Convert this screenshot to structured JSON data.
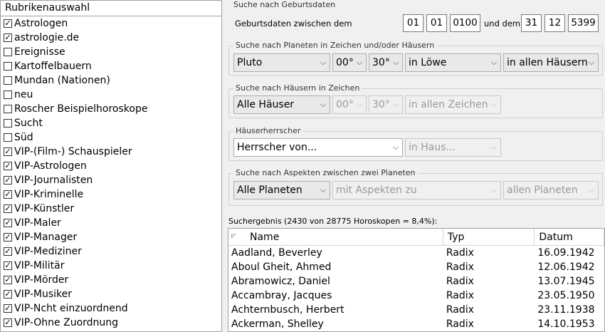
{
  "categories": {
    "header": "Rubrikenauswahl",
    "items": [
      {
        "label": "Astrologen",
        "checked": true
      },
      {
        "label": "astrologie.de",
        "checked": true
      },
      {
        "label": "Ereignisse",
        "checked": false
      },
      {
        "label": "Kartoffelbauern",
        "checked": false
      },
      {
        "label": "Mundan (Nationen)",
        "checked": false
      },
      {
        "label": "neu",
        "checked": false
      },
      {
        "label": "Roscher Beispielhoroskope",
        "checked": false
      },
      {
        "label": "Sucht",
        "checked": false
      },
      {
        "label": "Süd",
        "checked": false
      },
      {
        "label": "VIP-(Film-) Schauspieler",
        "checked": true
      },
      {
        "label": "VIP-Astrologen",
        "checked": true
      },
      {
        "label": "VIP-Journalisten",
        "checked": true
      },
      {
        "label": "VIP-Kriminelle",
        "checked": true
      },
      {
        "label": "VIP-Künstler",
        "checked": true
      },
      {
        "label": "VIP-Maler",
        "checked": true
      },
      {
        "label": "VIP-Manager",
        "checked": true
      },
      {
        "label": "VIP-Mediziner",
        "checked": true
      },
      {
        "label": "VIP-Militär",
        "checked": true
      },
      {
        "label": "VIP-Mörder",
        "checked": true
      },
      {
        "label": "VIP-Musiker",
        "checked": true
      },
      {
        "label": "VIP-Ncht einzuordnend",
        "checked": true
      },
      {
        "label": "VIP-Ohne Zuordnung",
        "checked": true
      }
    ]
  },
  "birth": {
    "title": "Suche nach Geburtsdaten",
    "label_between": "Geburtsdaten zwischen dem",
    "label_and": "und dem",
    "from_day": "01",
    "from_month": "01",
    "from_year": "0100",
    "to_day": "31",
    "to_month": "12",
    "to_year": "5399"
  },
  "planets": {
    "title": "Suche nach Planeten in Zeichen und/oder Häusern",
    "planet": "Pluto",
    "deg_from": "00°",
    "deg_to": "30°",
    "sign": "in Löwe",
    "house": "in allen Häusern"
  },
  "houses": {
    "title": "Suche nach Häusern in Zeichen",
    "house": "Alle Häuser",
    "deg_from": "00°",
    "deg_to": "30°",
    "sign": "in allen Zeichen"
  },
  "ruler": {
    "title": "Häuserherrscher",
    "ruler": "Herrscher von...",
    "house": "in Haus..."
  },
  "aspects": {
    "title": "Suche nach Aspekten zwischen zwei Planeten",
    "planet1": "Alle Planeten",
    "aspect": "mit Aspekten zu",
    "planet2": "allen Planeten"
  },
  "results": {
    "summary": "Suchergebnis (2430 von 28775 Horoskopen = 8,4%):",
    "columns": {
      "name": "Name",
      "type": "Typ",
      "date": "Datum"
    },
    "rows": [
      {
        "name": "Aadland, Beverley",
        "type": "Radix",
        "date": "16.09.1942"
      },
      {
        "name": "Aboul Gheit, Ahmed",
        "type": "Radix",
        "date": "12.06.1942"
      },
      {
        "name": "Abramowicz, Daniel",
        "type": "Radix",
        "date": "13.07.1945"
      },
      {
        "name": "Accambray, Jacques",
        "type": "Radix",
        "date": "23.05.1950"
      },
      {
        "name": "Achternbusch, Herbert",
        "type": "Radix",
        "date": "23.11.1938"
      },
      {
        "name": "Ackerman, Shelley",
        "type": "Radix",
        "date": "14.10.1953"
      }
    ]
  }
}
